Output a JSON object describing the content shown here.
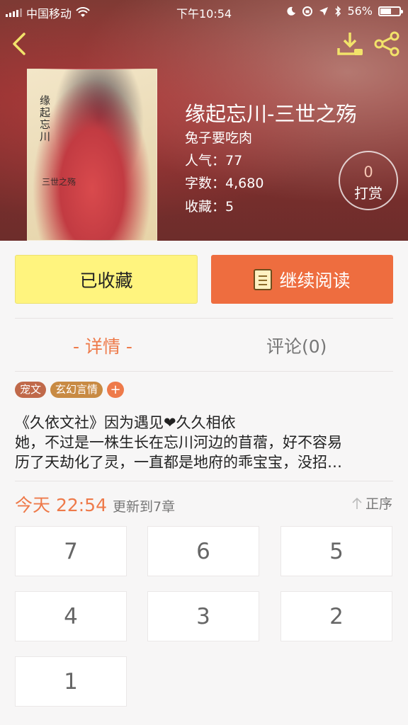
{
  "status_bar": {
    "carrier": "中国移动",
    "time": "下午10:54",
    "battery": "56%"
  },
  "book": {
    "cover_title": "缘起忘川",
    "cover_subtitle": "三世之殇",
    "title": "缘起忘川-三世之殇",
    "author": "兔子要吃肉",
    "popularity_label": "人气：",
    "popularity": "77",
    "words_label": "字数：",
    "words": "4,680",
    "favorites_label": "收藏：",
    "favorites": "5"
  },
  "tip": {
    "count": "0",
    "label": "打赏"
  },
  "actions": {
    "favorited_label": "已收藏",
    "continue_label": "继续阅读"
  },
  "tabs": {
    "detail": "- 详情 -",
    "comments": "评论(0)"
  },
  "tags": [
    "宠文",
    "玄幻言情"
  ],
  "tag_add": "+",
  "description": [
    "《久依文社》因为遇见❤久久相依",
    "她，不过是一株生长在忘川河边的苜蓿，好不容易",
    "历了天劫化了灵，一直都是地府的乖宝宝，没招…"
  ],
  "update": {
    "time": "今天 22:54",
    "text": "更新到7章",
    "sort_label": "正序"
  },
  "chapters": [
    "7",
    "6",
    "5",
    "4",
    "3",
    "2",
    "1"
  ],
  "colors": {
    "accent": "#ee6d3f",
    "favorite_button": "#fff47e",
    "hero": "#8a2f2e"
  },
  "icons": {
    "back": "chevron-left-icon",
    "download": "download-icon",
    "share": "share-icon",
    "read": "book-icon",
    "sort": "arrow-up-icon"
  }
}
